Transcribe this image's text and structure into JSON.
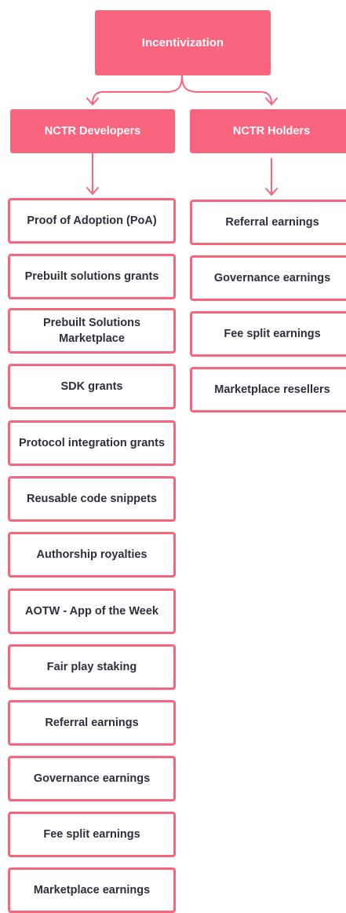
{
  "diagram": {
    "root": {
      "label": "Incentivization"
    },
    "branches": [
      {
        "label": "NCTR Developers",
        "items": [
          "Proof of Adoption (PoA)",
          "Prebuilt solutions grants",
          "Prebuilt Solutions Marketplace",
          "SDK grants",
          "Protocol integration grants",
          "Reusable code snippets",
          "Authorship royalties",
          "AOTW - App of the Week",
          "Fair play staking",
          "Referral earnings",
          "Governance earnings",
          "Fee split earnings",
          "Marketplace earnings"
        ]
      },
      {
        "label": "NCTR Holders",
        "items": [
          "Referral earnings",
          "Governance earnings",
          "Fee split earnings",
          "Marketplace resellers"
        ]
      }
    ]
  },
  "colors": {
    "accent": "#f9647f",
    "text_dark": "#2f2f3a",
    "text_light": "#ffffff"
  }
}
